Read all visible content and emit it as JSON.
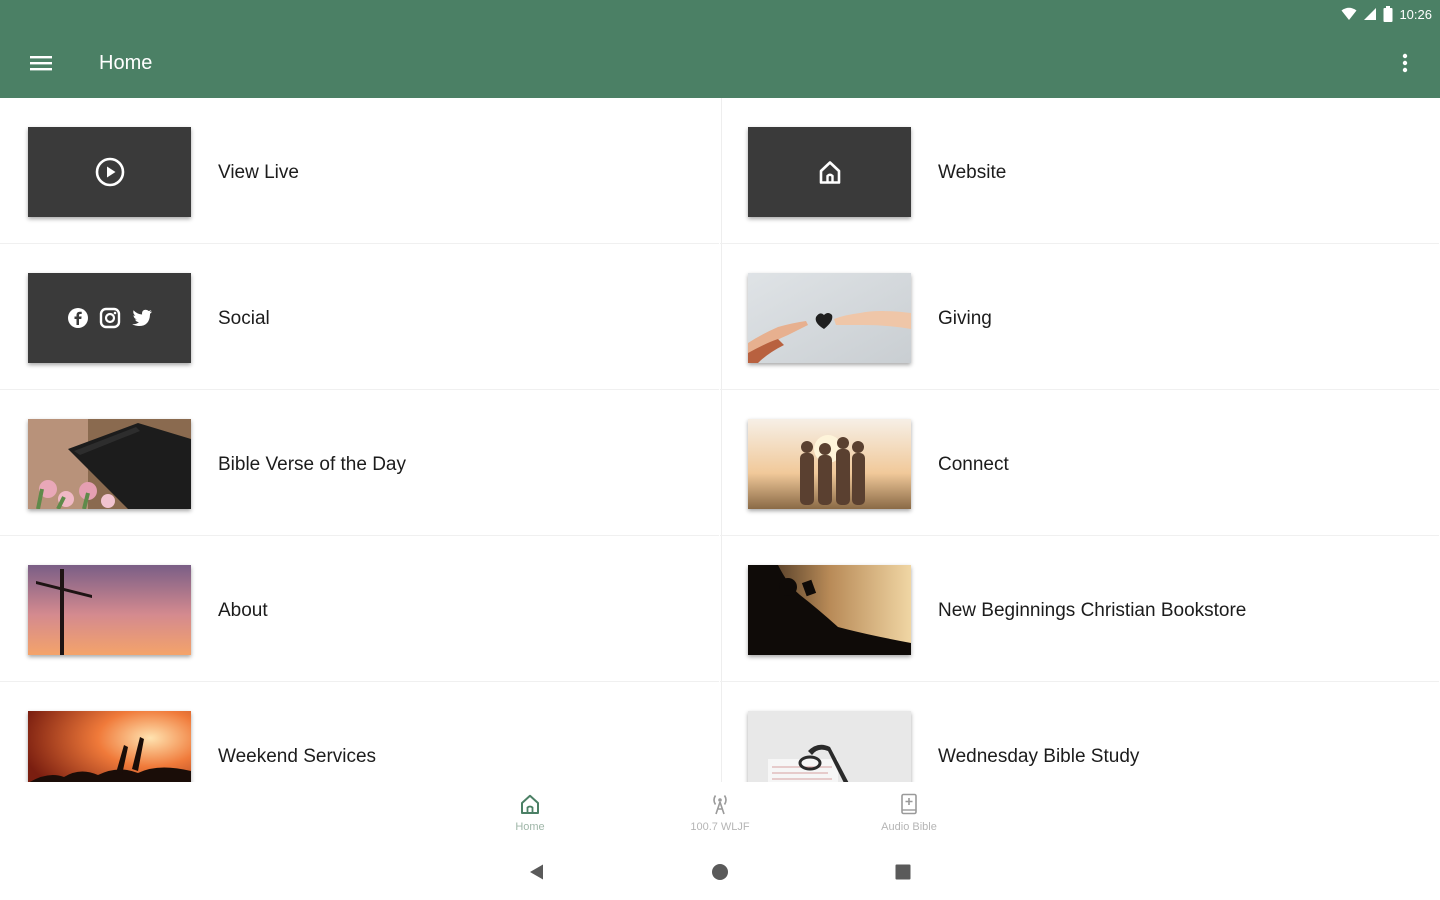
{
  "status_bar": {
    "time": "10:26"
  },
  "app_bar": {
    "title": "Home",
    "color": "#4b8065"
  },
  "tiles": [
    {
      "label": "View Live",
      "thumb": "play-icon"
    },
    {
      "label": "Website",
      "thumb": "home-icon"
    },
    {
      "label": "Social",
      "thumb": "social-icons"
    },
    {
      "label": "Giving",
      "thumb": "hands-heart-photo"
    },
    {
      "label": "Bible Verse of the Day",
      "thumb": "bible-tulips-photo"
    },
    {
      "label": "Connect",
      "thumb": "friends-sunset-photo"
    },
    {
      "label": "About",
      "thumb": "cross-sky-photo"
    },
    {
      "label": "New Beginnings Christian Bookstore",
      "thumb": "reading-silhouette-photo"
    },
    {
      "label": "Weekend Services",
      "thumb": "worship-crowd-photo"
    },
    {
      "label": "Wednesday Bible Study",
      "thumb": "glasses-book-photo"
    }
  ],
  "bottom_nav": [
    {
      "label": "Home",
      "icon": "home-icon",
      "active": true
    },
    {
      "label": "100.7 WLJF",
      "icon": "radio-tower-icon",
      "active": false
    },
    {
      "label": "Audio Bible",
      "icon": "bible-plus-icon",
      "active": false
    }
  ]
}
